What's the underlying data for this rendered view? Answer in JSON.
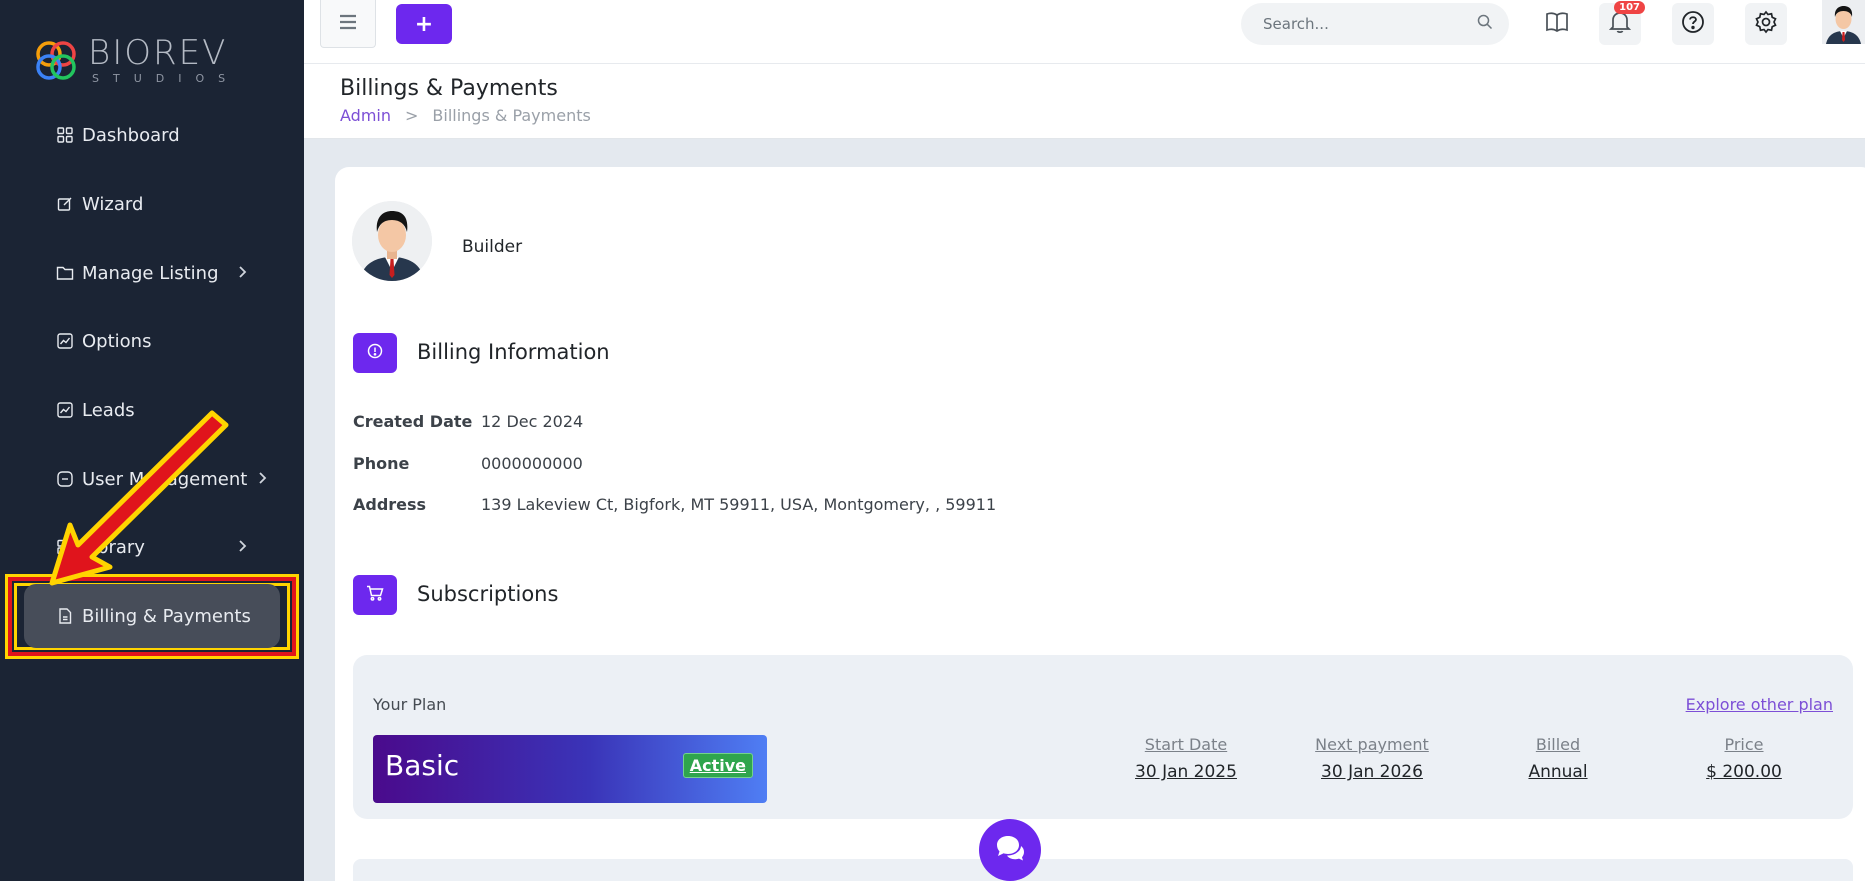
{
  "brand": {
    "name": "BIOREV",
    "sub": "STUDIOS"
  },
  "sidebar": {
    "items": [
      {
        "label": "Dashboard",
        "icon": "grid-icon"
      },
      {
        "label": "Wizard",
        "icon": "edit-icon"
      },
      {
        "label": "Manage Listing",
        "icon": "folder-icon",
        "has_children": true
      },
      {
        "label": "Options",
        "icon": "chart-icon"
      },
      {
        "label": "Leads",
        "icon": "chart-icon"
      },
      {
        "label": "User Management",
        "icon": "user-minus-icon",
        "has_children": true
      },
      {
        "label": "Library",
        "icon": "server-icon",
        "has_children": true
      },
      {
        "label": "Billing & Payments",
        "icon": "document-icon",
        "active": true
      }
    ]
  },
  "topbar": {
    "add_label": "+",
    "search_placeholder": "Search...",
    "notifications_count": "107"
  },
  "page": {
    "title": "Billings & Payments",
    "breadcrumb": [
      "Admin",
      "Billings & Payments"
    ],
    "breadcrumb_sep": ">"
  },
  "profile": {
    "name": "Builder"
  },
  "billing": {
    "title": "Billing Information",
    "rows": [
      {
        "label": "Created Date",
        "value": "12 Dec 2024"
      },
      {
        "label": "Phone",
        "value": "0000000000"
      },
      {
        "label": "Address",
        "value": "139 Lakeview Ct, Bigfork, MT 59911, USA, Montgomery, , 59911"
      }
    ]
  },
  "subscriptions": {
    "title": "Subscriptions",
    "your_plan_label": "Your Plan",
    "explore_label": "Explore other plan",
    "plan_name": "Basic",
    "plan_status": "Active",
    "columns": [
      {
        "header": "Start Date",
        "value": "30 Jan 2025"
      },
      {
        "header": "Next payment",
        "value": "30 Jan 2026"
      },
      {
        "header": "Billed",
        "value": "Annual"
      },
      {
        "header": "Price",
        "value": "$ 200.00"
      }
    ]
  },
  "colors": {
    "accent": "#6d28ee",
    "sidebar_bg": "#1b2434",
    "active_item": "#474d59",
    "annotation_red": "#e0141c",
    "annotation_yellow": "#ffd400"
  }
}
